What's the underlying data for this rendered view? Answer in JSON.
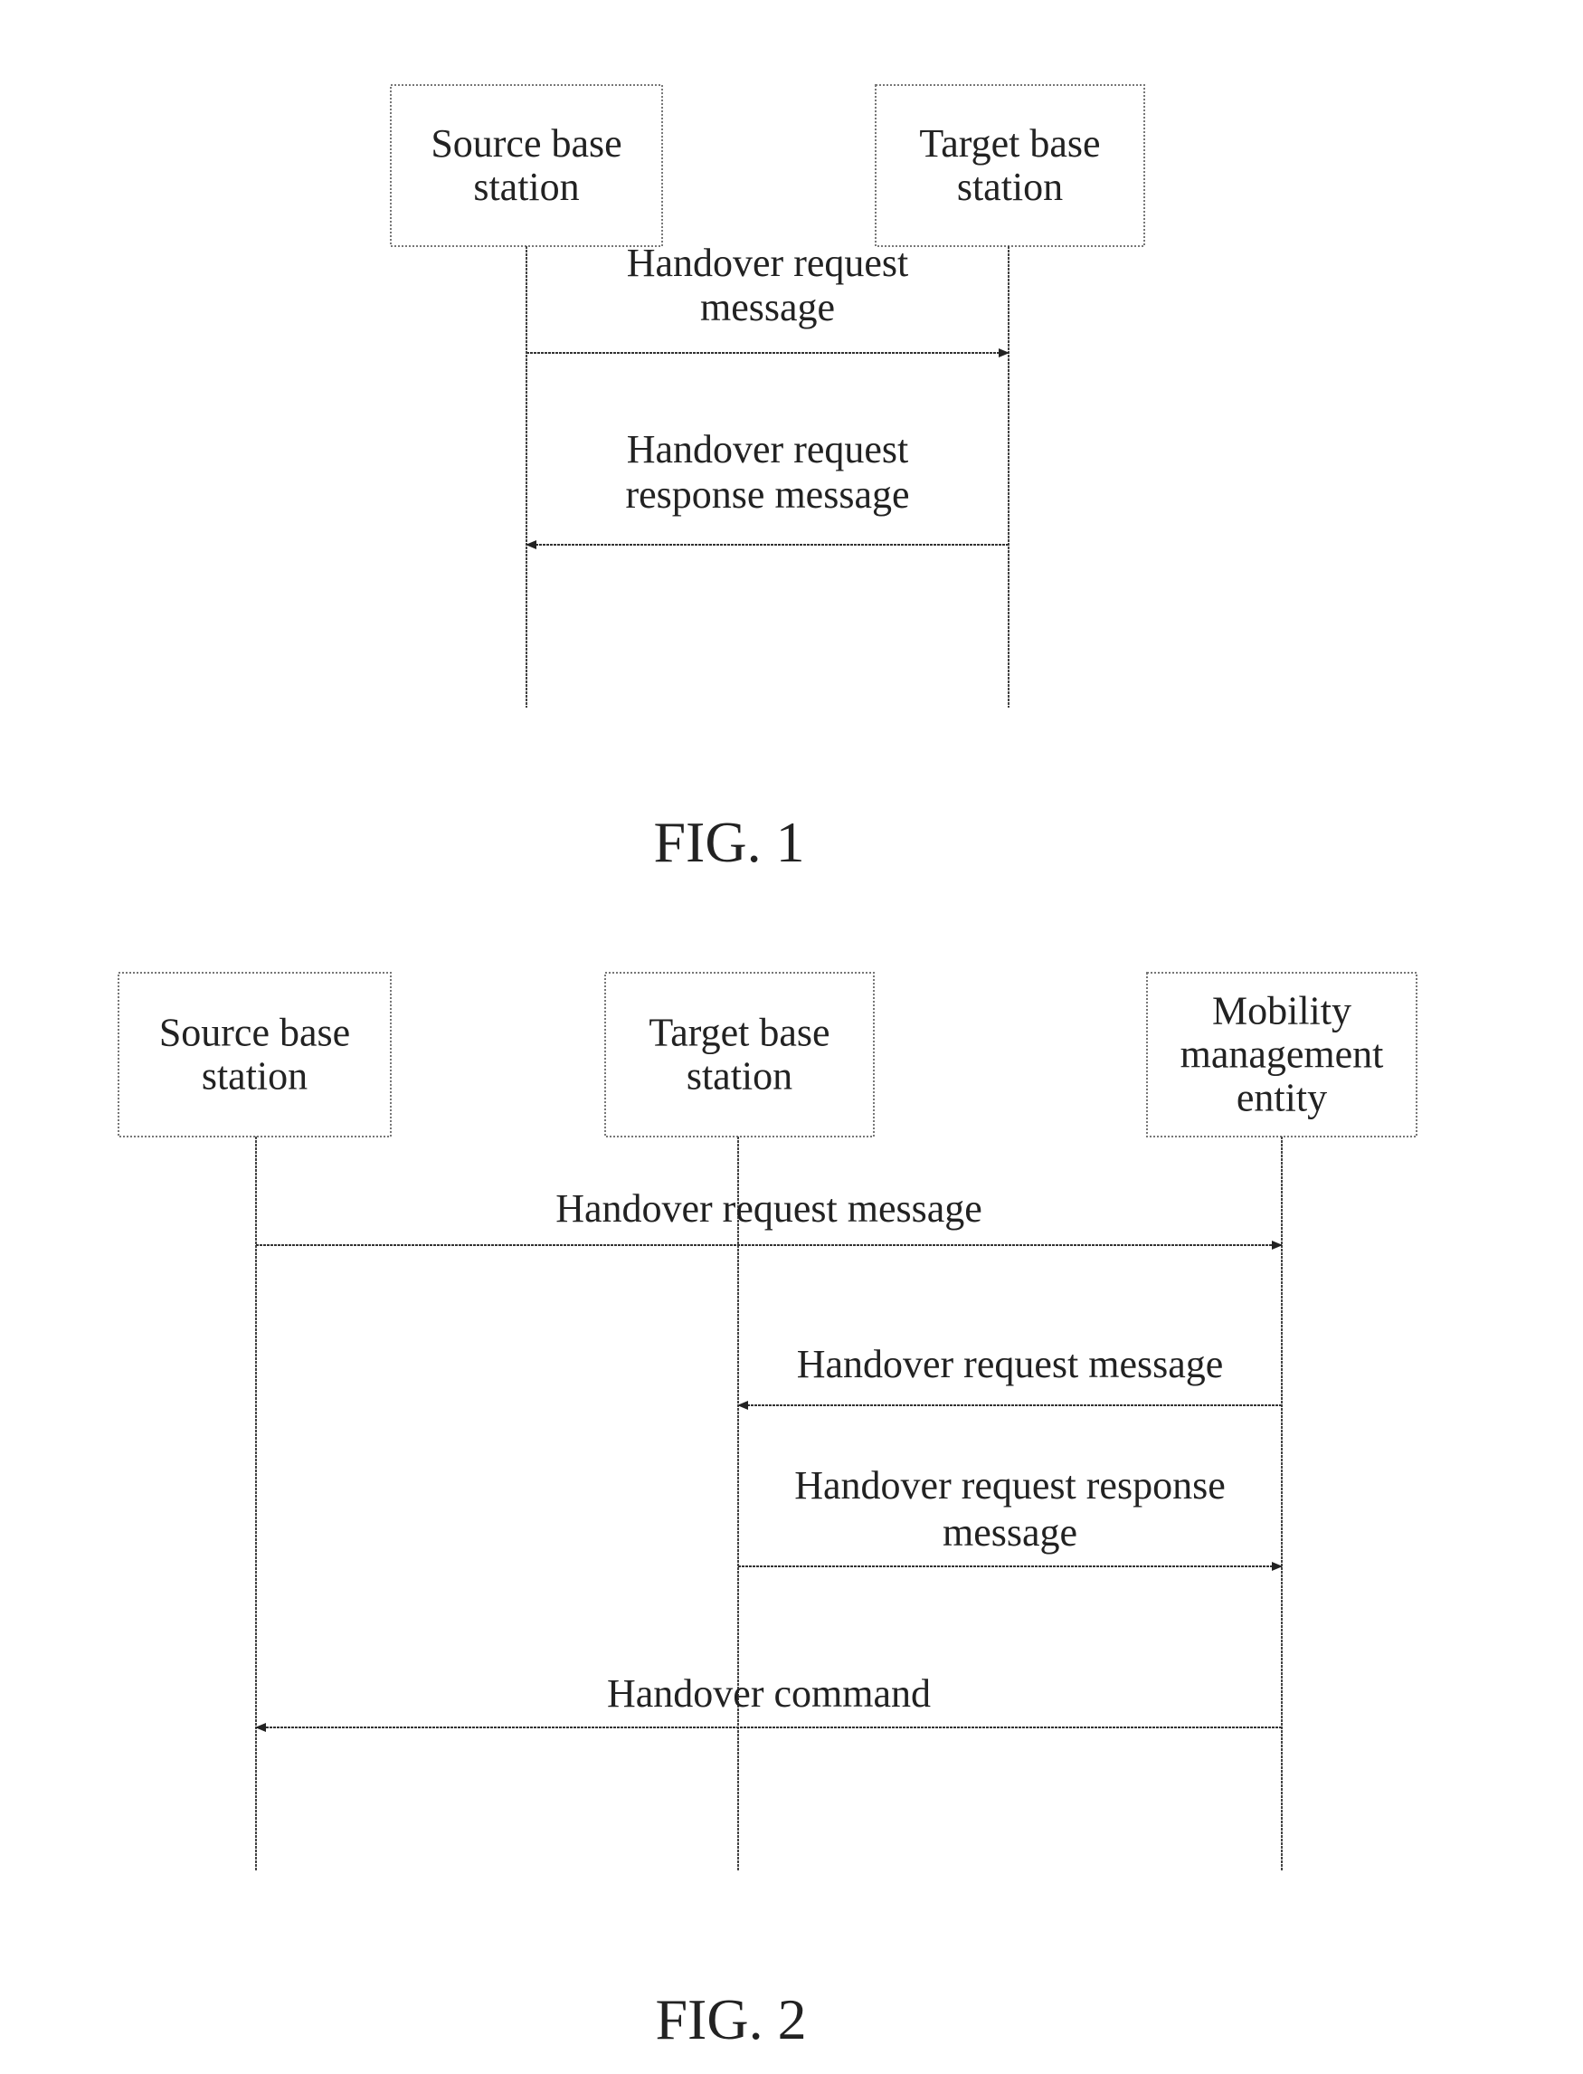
{
  "figures": [
    {
      "caption": "FIG. 1",
      "participants": [
        {
          "id": "source",
          "lines": [
            "Source base",
            "station"
          ]
        },
        {
          "id": "target",
          "lines": [
            "Target base",
            "station"
          ]
        }
      ],
      "messages": [
        {
          "from": "source",
          "to": "target",
          "lines": [
            "Handover request",
            "message"
          ]
        },
        {
          "from": "target",
          "to": "source",
          "lines": [
            "Handover request",
            "response message"
          ]
        }
      ]
    },
    {
      "caption": "FIG. 2",
      "participants": [
        {
          "id": "source",
          "lines": [
            "Source base",
            "station"
          ]
        },
        {
          "id": "target",
          "lines": [
            "Target base",
            "station"
          ]
        },
        {
          "id": "mme",
          "lines": [
            "Mobility",
            "management",
            "entity"
          ]
        }
      ],
      "messages": [
        {
          "from": "source",
          "to": "mme",
          "lines": [
            "Handover request message"
          ]
        },
        {
          "from": "mme",
          "to": "target",
          "lines": [
            "Handover request message"
          ]
        },
        {
          "from": "target",
          "to": "mme",
          "lines": [
            "Handover request response",
            "message"
          ]
        },
        {
          "from": "mme",
          "to": "source",
          "lines": [
            "Handover command"
          ]
        }
      ]
    }
  ]
}
